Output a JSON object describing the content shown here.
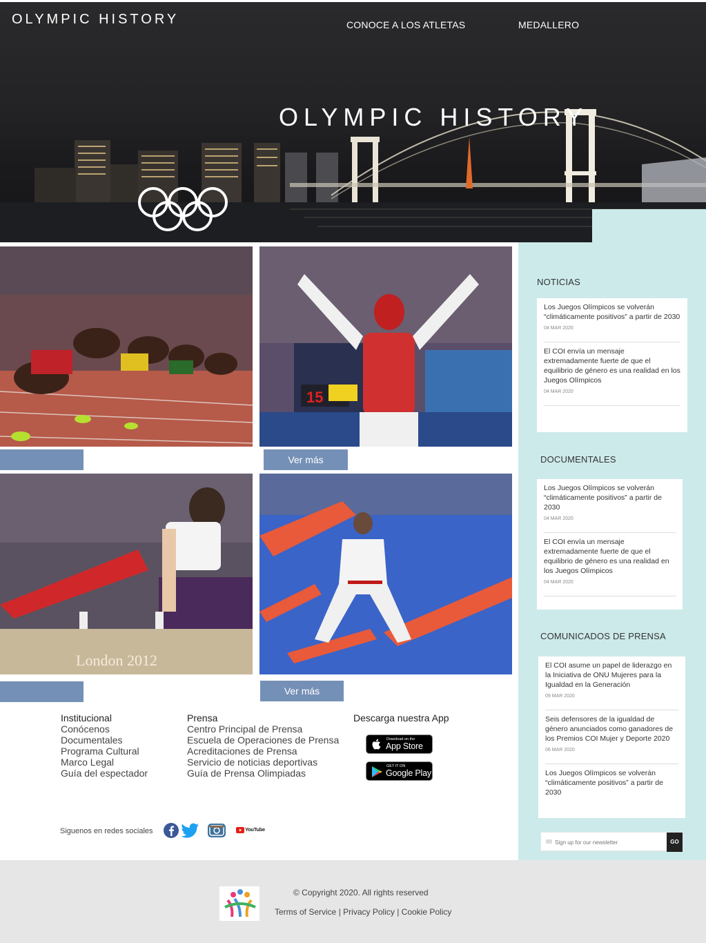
{
  "header": {
    "brand": "OLYMPIC HISTORY",
    "nav": [
      "CONOCE A LOS ATLETAS",
      "MEDALLERO"
    ],
    "hero_title": "OLYMPIC HISTORY"
  },
  "photos": {
    "buttons": [
      "",
      "Ver más",
      "",
      "Ver más"
    ]
  },
  "sidebar": {
    "noticias": {
      "heading": "NOTICIAS",
      "items": [
        {
          "text": "Los Juegos Olímpicos se volverán “climáticamente positivos” a partir de 2030",
          "date": "04 MAR 2020"
        },
        {
          "text": "El COI envía un mensaje extremadamente fuerte de que el equilibrio de género es una realidad en los Juegos Olímpicos",
          "date": "04 MAR 2020"
        }
      ]
    },
    "documentales": {
      "heading": "DOCUMENTALES",
      "items": [
        {
          "text": "Los Juegos Olímpicos se volverán “climáticamente positivos” a partir de 2030",
          "date": "04 MAR 2020"
        },
        {
          "text": "El COI envía un mensaje extremadamente fuerte de que el equilibrio de género es una realidad en los Juegos Olímpicos",
          "date": "04 MAR 2020"
        }
      ]
    },
    "comunicados": {
      "heading": "COMUNICADOS DE PRENSA",
      "items": [
        {
          "text": "El COI asume un papel de liderazgo en la Iniciativa de ONU Mujeres para la Igualdad en la Generación",
          "date": "09 MAR 2020"
        },
        {
          "text": "Seis defensores de la igualdad de género anunciados como ganadores de los Premios COI Mujer y Deporte 2020",
          "date": "06 MAR 2020"
        },
        {
          "text": "Los Juegos Olímpicos se volverán “climáticamente positivos” a partir de 2030",
          "date": ""
        }
      ]
    },
    "newsletter": {
      "placeholder": "Sign up for our newsletter",
      "button": "GO"
    }
  },
  "footer": {
    "institucional": {
      "heading": "Institucional",
      "links": [
        "Conócenos",
        "Documentales",
        "Programa Cultural",
        "Marco Legal",
        "Guía del espectador"
      ]
    },
    "prensa": {
      "heading": "Prensa",
      "links": [
        "Centro Principal de Prensa",
        "Escuela de Operaciones de Prensa",
        "Acreditaciones de Prensa",
        "Servicio de noticias deportivas",
        "Guía de Prensa Olimpiadas"
      ]
    },
    "app": {
      "heading": "Descarga nuestra App",
      "appstore_small": "Download on the",
      "appstore_big": "App Store",
      "googleplay_small": "GET IT ON",
      "googleplay_big": "Google Play"
    },
    "social_label": "Siguenos en redes sociales",
    "social_icons": [
      "facebook-icon",
      "twitter-icon",
      "instagram-icon",
      "youtube-icon"
    ],
    "youtube_text": "YouTube",
    "copyright": "© Copyright 2020. All rights reserved",
    "legal": [
      "Terms of Service",
      "Privacy Policy",
      "Cookie Policy"
    ]
  }
}
